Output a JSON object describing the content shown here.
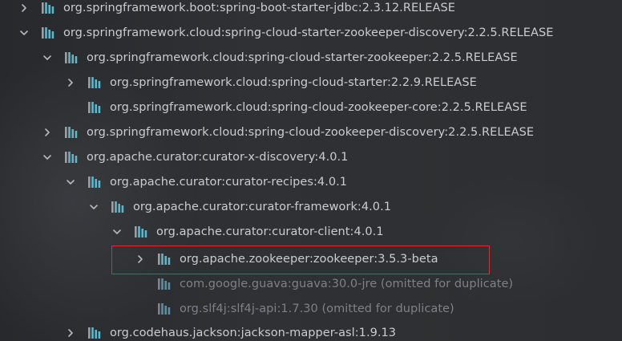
{
  "rows": [
    {
      "label": "org.springframework.boot:spring-boot-starter-jdbc:2.3.12.RELEASE",
      "expander": "collapsed",
      "omitted": false,
      "selected": false
    },
    {
      "label": "org.springframework.cloud:spring-cloud-starter-zookeeper-discovery:2.2.5.RELEASE",
      "expander": "expanded",
      "omitted": false,
      "selected": false
    },
    {
      "label": "org.springframework.cloud:spring-cloud-starter-zookeeper:2.2.5.RELEASE",
      "expander": "expanded",
      "omitted": false,
      "selected": false
    },
    {
      "label": "org.springframework.cloud:spring-cloud-starter:2.2.9.RELEASE",
      "expander": "collapsed",
      "omitted": false,
      "selected": false
    },
    {
      "label": "org.springframework.cloud:spring-cloud-zookeeper-core:2.2.5.RELEASE",
      "expander": "none",
      "omitted": false,
      "selected": false
    },
    {
      "label": "org.springframework.cloud:spring-cloud-zookeeper-discovery:2.2.5.RELEASE",
      "expander": "collapsed",
      "omitted": false,
      "selected": false
    },
    {
      "label": "org.apache.curator:curator-x-discovery:4.0.1",
      "expander": "expanded",
      "omitted": false,
      "selected": false
    },
    {
      "label": "org.apache.curator:curator-recipes:4.0.1",
      "expander": "expanded",
      "omitted": false,
      "selected": false
    },
    {
      "label": "org.apache.curator:curator-framework:4.0.1",
      "expander": "expanded",
      "omitted": false,
      "selected": false
    },
    {
      "label": "org.apache.curator:curator-client:4.0.1",
      "expander": "expanded",
      "omitted": false,
      "selected": false
    },
    {
      "label": "org.apache.zookeeper:zookeeper:3.5.3-beta",
      "expander": "collapsed",
      "omitted": false,
      "selected": true
    },
    {
      "label": "com.google.guava:guava:30.0-jre (omitted for duplicate)",
      "expander": "none",
      "omitted": true,
      "selected": false
    },
    {
      "label": "org.slf4j:slf4j-api:1.7.30 (omitted for duplicate)",
      "expander": "none",
      "omitted": true,
      "selected": false
    },
    {
      "label": "org.codehaus.jackson:jackson-mapper-asl:1.9.13",
      "expander": "collapsed",
      "omitted": false,
      "selected": false
    }
  ],
  "icons": {
    "expander_collapsed": "chevron-right-icon",
    "expander_expanded": "chevron-down-icon",
    "library": "library-icon"
  },
  "colors": {
    "background": "#2b2d30",
    "text": "#c9ccd1",
    "omitted_text": "#7d8188",
    "library_icon_primary": "#5fb6c9",
    "library_icon_secondary": "#9aa0a6",
    "highlight_border": "#c9363a"
  }
}
